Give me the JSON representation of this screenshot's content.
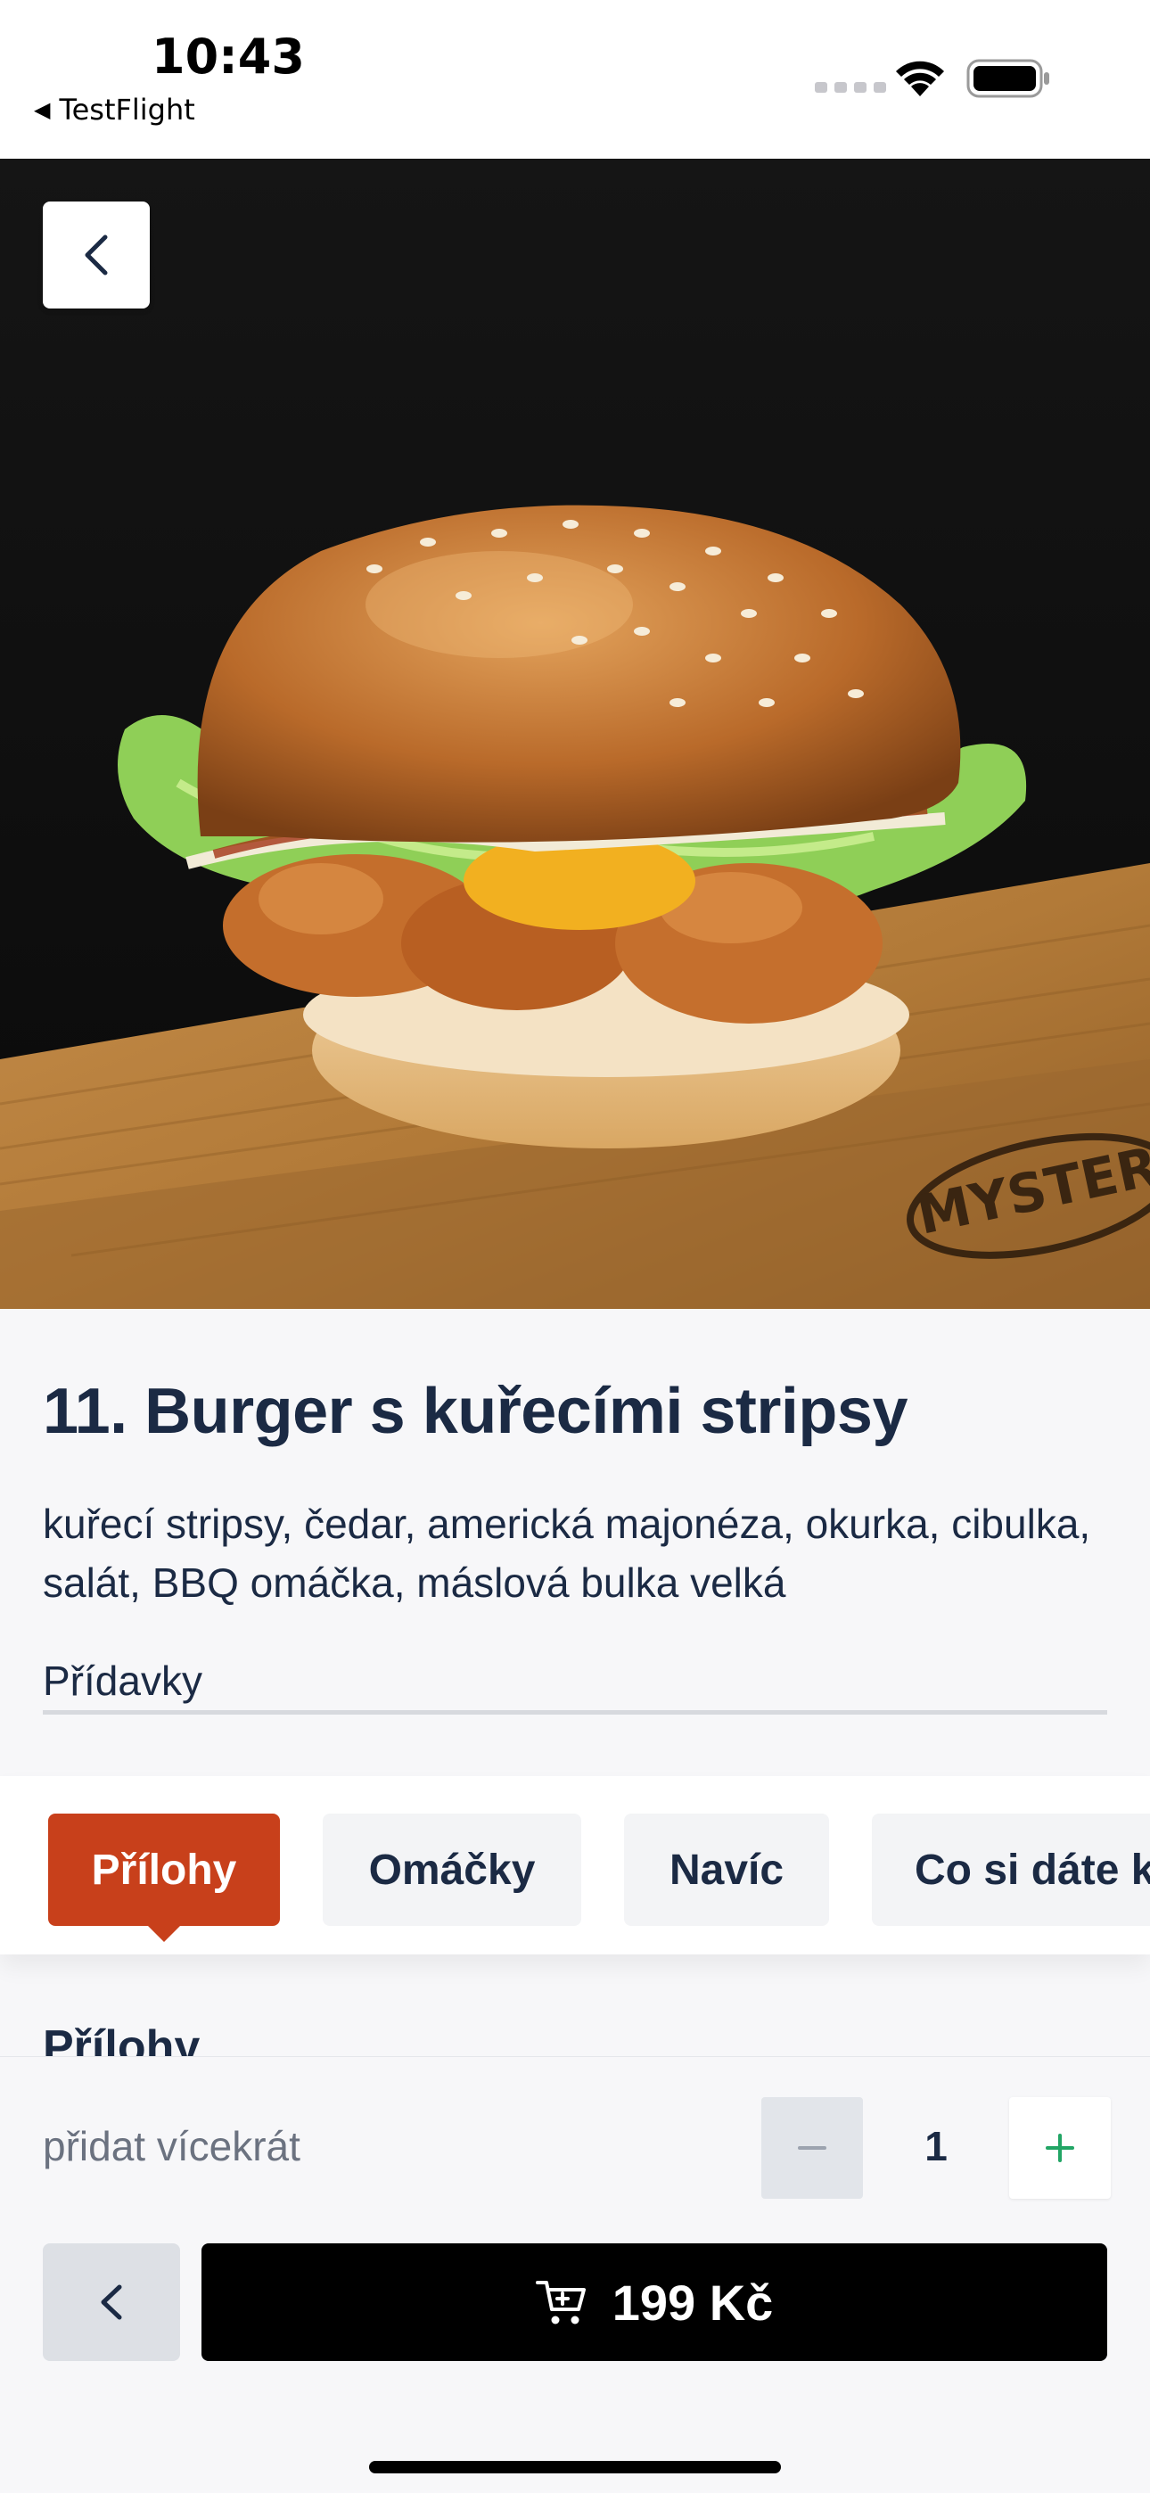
{
  "status_bar": {
    "time": "10:43",
    "back_app": "TestFlight"
  },
  "product": {
    "title": "11. Burger s kuřecími stripsy",
    "description": "kuřecí stripsy, čedar, americká majonéza, okurka, cibulka, salát, BBQ omáčka, máslová bulka velká",
    "addons_label": "Přídavky",
    "image_brand_text": "MYSTERY"
  },
  "tabs": [
    {
      "label": "Přílohy",
      "active": true
    },
    {
      "label": "Omáčky",
      "active": false
    },
    {
      "label": "Navíc",
      "active": false
    },
    {
      "label": "Co si dáte k",
      "active": false
    }
  ],
  "section": {
    "heading": "Přílohy"
  },
  "footer": {
    "multi_label": "přidat vícekrát",
    "quantity": "1",
    "cart_price": "199 Kč"
  },
  "colors": {
    "accent": "#c8401b",
    "text": "#1b2a44",
    "plus_green": "#22a565"
  }
}
